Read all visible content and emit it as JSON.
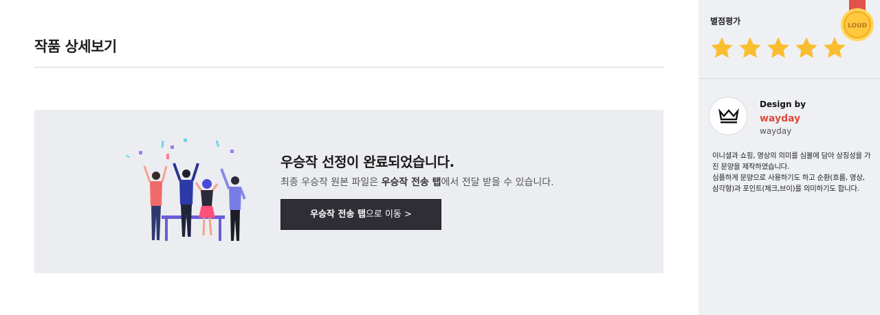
{
  "page": {
    "title": "작품 상세보기"
  },
  "banner": {
    "heading": "우승작 선정이 완료되었습니다.",
    "desc_prefix": "최종 우승작 원본 파일은 ",
    "desc_bold": "우승작 전송 탭",
    "desc_suffix": "에서 전달 받을 수 있습니다.",
    "button_bold": "우승작 전송 탭",
    "button_rest": "으로 이동 >"
  },
  "sidebar": {
    "rating_label": "별점평가",
    "rating_value": 5,
    "rating_max": 5,
    "medal_text": "LOUD",
    "design_by": "Design by",
    "designer_name": "wayday",
    "designer_id": "wayday",
    "description_1": "이니셜과 쇼핑, 영상의 의미를 심볼에 담아 상징성을 가진 문양을 제작하였습니다.",
    "description_2": "심플하게 문양으로 사용하기도 하고 순환(흐름, 영상, 삼각형)과 포인트(체크,브이)를 의미하기도 합니다."
  },
  "colors": {
    "banner_bg": "#ebedf0",
    "sidebar_bg": "#eef0f3",
    "star": "#fbbd30",
    "button_bg": "#2f2d36",
    "designer_name": "#e04a3a"
  },
  "icons": {
    "medal": "medal-icon",
    "avatar": "crown-icon",
    "star": "star-icon"
  }
}
